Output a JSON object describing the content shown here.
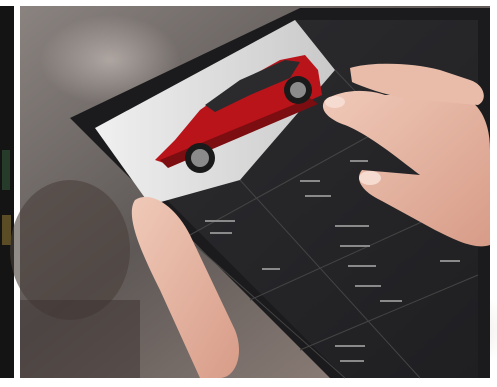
{
  "scene": {
    "subject": "hand-holding-tablet",
    "tablet_screen": {
      "hero_car_color": "#b8141a",
      "ui_theme": "dark",
      "panel_labels": []
    }
  },
  "colors": {
    "background_blur": "#6d6a69",
    "tablet_bezel": "#1b1b1d",
    "screen_dark": "#2a2a2c",
    "car_red": "#b8141a",
    "skin": "#e8b8a6"
  }
}
